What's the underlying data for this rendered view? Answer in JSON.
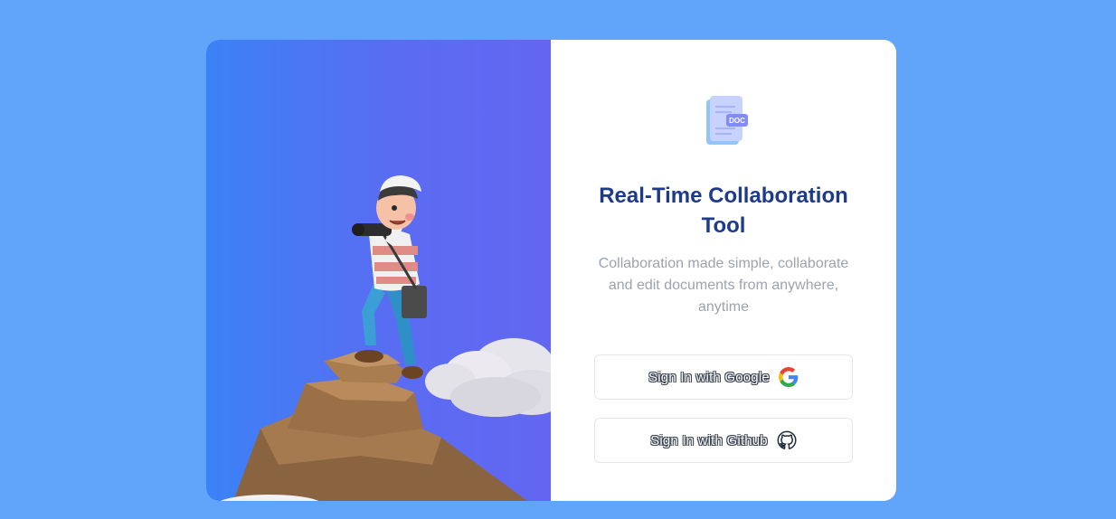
{
  "app": {
    "title": "Real-Time Collaboration Tool",
    "subtitle": "Collaboration made simple, collaborate and edit documents from anywhere, anytime",
    "logo_badge": "DOC"
  },
  "auth": {
    "google_label": "Sign In with Google",
    "github_label": "Sign In with Github",
    "google_icon": "google-icon",
    "github_icon": "github-icon"
  },
  "colors": {
    "background": "#60a5fa",
    "title": "#1e3a8a",
    "subtitle": "#9ca3af",
    "gradient_start": "#3b82f6",
    "gradient_end": "#6366f1"
  }
}
